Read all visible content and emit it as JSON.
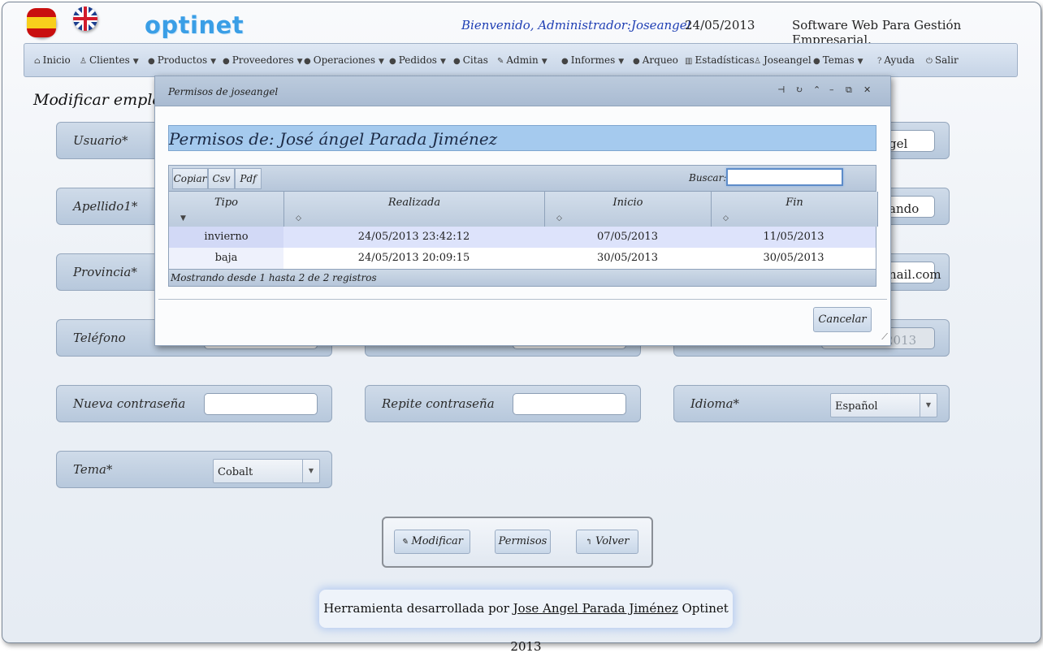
{
  "header": {
    "logo": "optinet",
    "welcome": "Bienvenido, Administrador:Joseangel",
    "date": "24/05/2013",
    "slogan": "Software Web Para Gestión Empresarial."
  },
  "menu": {
    "inicio": "Inicio",
    "clientes": "Clientes",
    "productos": "Productos",
    "proveedores": "Proveedores",
    "operaciones": "Operaciones",
    "pedidos": "Pedidos",
    "citas": "Citas",
    "admin": "Admin",
    "informes": "Informes",
    "arqueo": "Arqueo",
    "estadisticas": "Estadísticas",
    "user": "Joseangel",
    "temas": "Temas",
    "ayuda": "Ayuda",
    "salir": "Salir"
  },
  "page": {
    "title": "Modificar emplead",
    "fields": {
      "usuario": "Usuario*",
      "usuario_val_partial": "gel",
      "apellido1": "Apellido1*",
      "apellido2_val_partial": "ando",
      "provincia": "Provincia*",
      "email_val_partial": "nail.com",
      "telefono": "Teléfono",
      "date_val_partial": "2013",
      "nueva": "Nueva contraseña",
      "repite": "Repite contraseña",
      "idioma": "Idioma*",
      "idioma_val": "Español",
      "tema": "Tema*",
      "tema_val": "Cobalt"
    },
    "buttons": {
      "modificar": "Modificar",
      "permisos": "Permisos",
      "volver": "Volver"
    }
  },
  "footer": {
    "prefix": "Herramienta desarrollada por ",
    "author": "Jose Angel Parada Jiménez",
    "suffix": " Optinet 2013"
  },
  "dialog": {
    "title": "Permisos de joseangel",
    "banner": "Permisos de: José ángel Parada Jiménez",
    "toolbar": {
      "copiar": "Copiar",
      "csv": "Csv",
      "pdf": "Pdf",
      "buscar": "Buscar:"
    },
    "columns": {
      "tipo": "Tipo",
      "realizada": "Realizada",
      "inicio": "Inicio",
      "fin": "Fin"
    },
    "rows": [
      {
        "tipo": "invierno",
        "realizada": "24/05/2013 23:42:12",
        "inicio": "07/05/2013",
        "fin": "11/05/2013"
      },
      {
        "tipo": "baja",
        "realizada": "24/05/2013 20:09:15",
        "inicio": "30/05/2013",
        "fin": "30/05/2013"
      }
    ],
    "info": "Mostrando desde 1 hasta 2 de 2 registros",
    "cancel": "Cancelar"
  },
  "icons": {
    "controls": [
      "pin-icon",
      "refresh-icon",
      "collapse-icon",
      "minimize-icon",
      "maximize-icon",
      "close-icon"
    ]
  },
  "colors": {
    "accent": "#3a9ee6",
    "banner": "#a5caee",
    "row_highlight": "#dde3fb"
  }
}
